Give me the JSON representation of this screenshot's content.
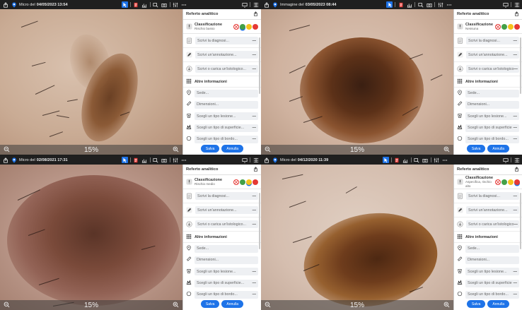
{
  "toolbar_right_icons": [
    "monitor-icon",
    "grid-icon"
  ],
  "panes": [
    {
      "label": "Micro del",
      "date": "04/05/2023 13:54",
      "zoom": "15%",
      "report": {
        "title": "Referto analitico",
        "classification_title": "Classificazione",
        "classification_value": "Rischio basso",
        "selected_face": "green",
        "diagnosis_placeholder": "Scrivi la diagnosi...",
        "annotation_placeholder": "Scrivi un'annotazione...",
        "histology_placeholder": "Scrivi o carica un'istologico...",
        "more_info": "Altre informazioni",
        "site": "Sede...",
        "dimensions": "Dimensioni...",
        "lesion_type": "Scegli un tipo lesione...",
        "surface_type": "Scegli un tipo di superficie...",
        "border_type": "Scegli un tipo di bordo...",
        "save": "Salva",
        "cancel": "Annulla"
      }
    },
    {
      "label": "Immagine del",
      "date": "03/05/2023 08:44",
      "zoom": "15%",
      "report": {
        "title": "Referto analitico",
        "classification_title": "Classificazione",
        "classification_value": "Nessuna",
        "selected_face": "none",
        "diagnosis_placeholder": "Scrivi la diagnosi...",
        "annotation_placeholder": "Scrivi un'annotazione...",
        "histology_placeholder": "Scrivi o carica un'istologico",
        "more_info": "Altre informazioni",
        "site": "Sede...",
        "dimensions": "Dimensioni...",
        "lesion_type": "Scegli un tipo lesione...",
        "surface_type": "Scegli un tipo di superficie",
        "border_type": "Scegli un tipo di bordo...",
        "save": "Salva",
        "cancel": "Annulla"
      }
    },
    {
      "label": "Micro del",
      "date": "02/08/2021 17:31",
      "zoom": "15%",
      "report": {
        "title": "Referto analitico",
        "classification_title": "Classificazione",
        "classification_value": "Rischio medio",
        "selected_face": "yellow",
        "diagnosis_placeholder": "Scrivi la diagnosi...",
        "annotation_placeholder": "Scrivi un'annotazione...",
        "histology_placeholder": "Scrivi o carica un'istologico...",
        "more_info": "Altre informazioni",
        "site": "Sede...",
        "dimensions": "Dimensioni...",
        "lesion_type": "Scegli un tipo lesione...",
        "surface_type": "Scegli un tipo di superficie...",
        "border_type": "Scegli un tipo di bordo...",
        "save": "Salva",
        "cancel": "Annulla"
      }
    },
    {
      "label": "Micro del",
      "date": "04/12/2020 11:39",
      "zoom": "15%",
      "report": {
        "title": "Referto analitico",
        "classification_title": "Classificazione",
        "classification_value": "Aspecifica, rischio alto",
        "selected_face": "red",
        "diagnosis_placeholder": "Scrivi la diagnosi...",
        "annotation_placeholder": "Scrivi un'annotazione...",
        "histology_placeholder": "Scrivi o carica un'istologico",
        "more_info": "Altre informazioni",
        "site": "Sede...",
        "dimensions": "Dimensioni...",
        "lesion_type": "Scegli un tipo lesione...",
        "surface_type": "Scegli un tipo di superficie",
        "border_type": "Scegli un tipo di bordo...",
        "save": "Salva",
        "cancel": "Annulla"
      }
    }
  ],
  "colors": {
    "accent": "#1e73e8",
    "risk_low": "#43a047",
    "risk_medium": "#f6c21d",
    "risk_high": "#e53935"
  }
}
